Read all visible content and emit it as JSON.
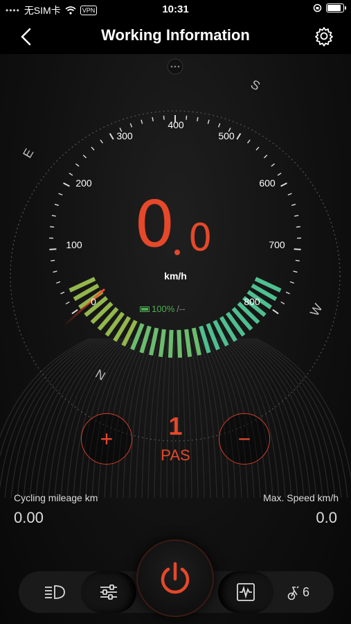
{
  "status_bar": {
    "carrier": "无SIM卡",
    "vpn": "VPN",
    "time": "10:31",
    "battery_level": 0.9
  },
  "nav": {
    "title": "Working Information",
    "back_icon": "chevron-left-icon",
    "settings_icon": "gear-icon"
  },
  "gauge": {
    "compass": [
      "S",
      "E",
      "W",
      "N"
    ],
    "ticks": [
      "0",
      "100",
      "200",
      "300",
      "400",
      "500",
      "600",
      "700",
      "800"
    ],
    "speed_integer": "0",
    "speed_decimal": "0",
    "speed_unit": "km/h",
    "battery_percent": "100%",
    "battery_extra": "/--",
    "battery_level": 1.0
  },
  "pas": {
    "level": "1",
    "label": "PAS",
    "plus": "+",
    "minus": "−"
  },
  "stats": {
    "mileage_label": "Cycling mileage km",
    "mileage_value": "0.00",
    "max_speed_label": "Max. Speed km/h",
    "max_speed_value": "0.0"
  },
  "bottom_bar": {
    "mode_count": "6"
  },
  "colors": {
    "accent": "#e5482a",
    "battery_green": "#4caf50"
  }
}
